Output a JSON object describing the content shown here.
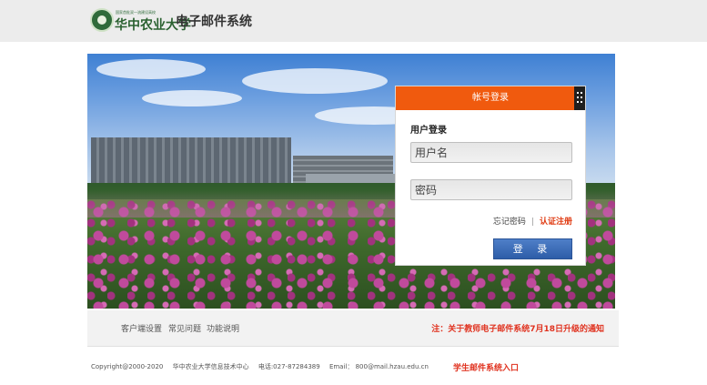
{
  "header": {
    "university_name": "华中农业大学",
    "university_subtitle": "国家首批双一流建设高校",
    "system_title": "电子邮件系统"
  },
  "login": {
    "tab_label": "帐号登录",
    "section_label": "用户登录",
    "username_placeholder": "用户名",
    "password_placeholder": "密码",
    "forgot_password": "忘记密码",
    "separator": "|",
    "verify_register": "认证注册",
    "submit_label": "登 录"
  },
  "nav": {
    "items": [
      "客户端设置",
      "常见问题",
      "功能说明"
    ],
    "notice": "注：关于教师电子邮件系统7月18日升级的通知"
  },
  "footer": {
    "copyright": "Copyright@2000-2020",
    "center": "华中农业大学信息技术中心",
    "phone": "电话:027-87284389",
    "email": "Email：  800@mail.hzau.edu.cn",
    "student_link": "学生邮件系统入口"
  },
  "colors": {
    "accent_orange": "#f05a0e",
    "login_blue": "#2d5da8",
    "notice_red": "#e0321f",
    "brand_green": "#2a6130"
  },
  "icons": {
    "logo": "university-seal-icon",
    "qr_toggle": "qr-code-icon"
  }
}
